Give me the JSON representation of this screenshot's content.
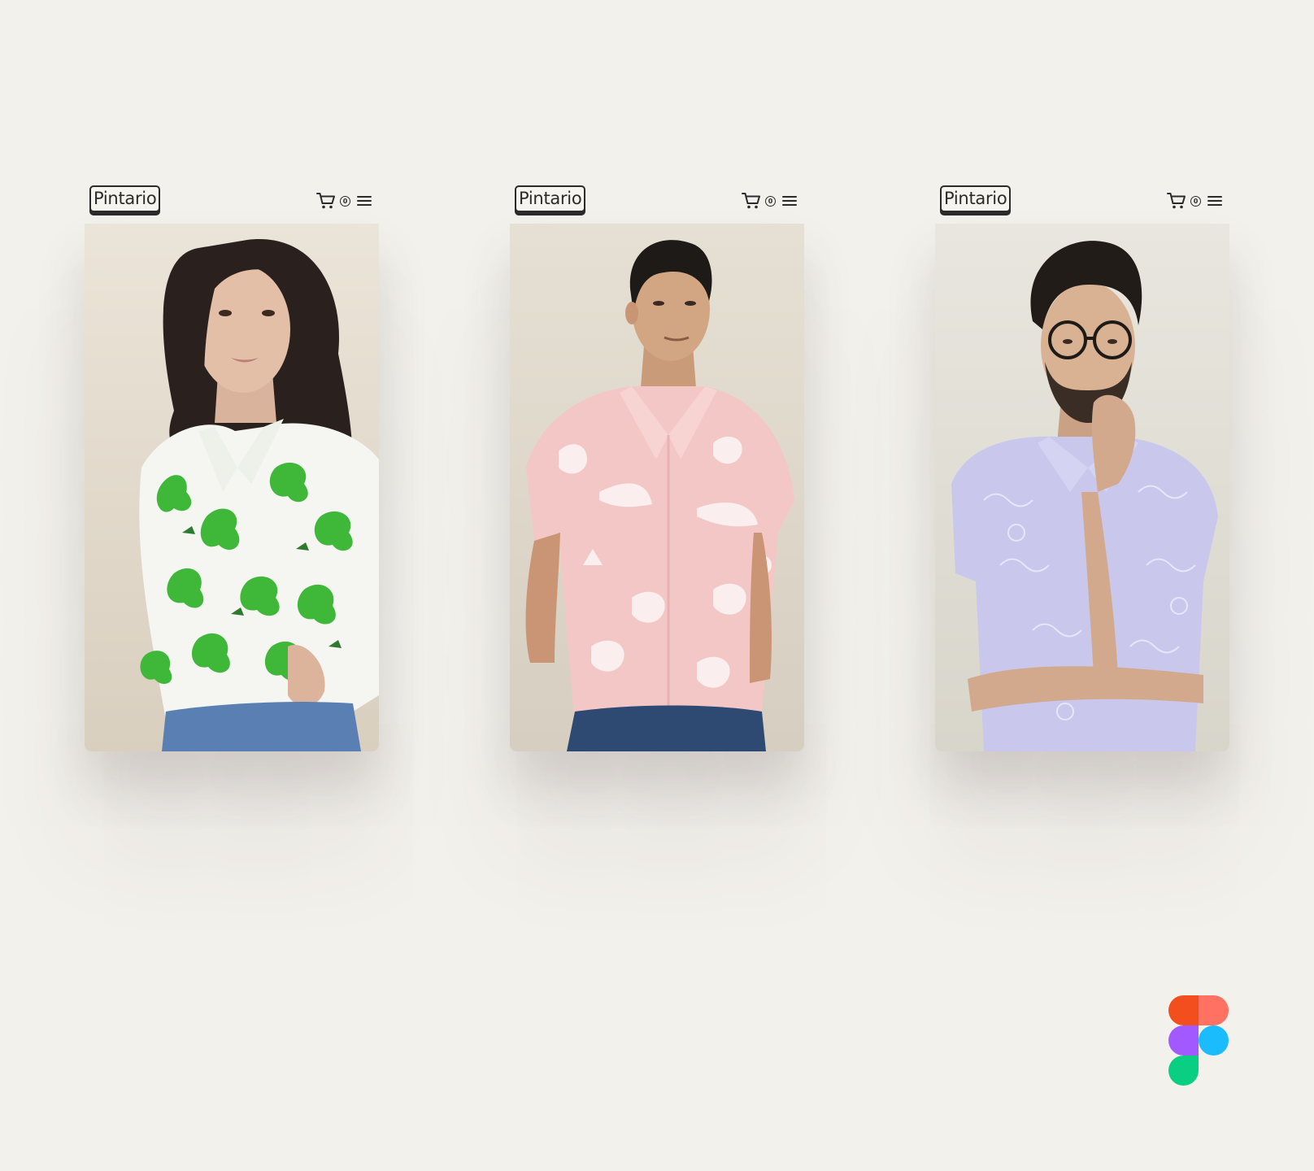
{
  "screens": [
    {
      "logo": "Pintario",
      "cart_count": "0",
      "photo": "woman in white shirt with green lizard print",
      "shirt_color": "#3fb83a",
      "background_color": "#e7dfd2"
    },
    {
      "logo": "Pintario",
      "cart_count": "0",
      "photo": "man in pink shirt with white toucan and flower print",
      "shirt_color": "#f3c7c6",
      "background_color": "#e4ddd1"
    },
    {
      "logo": "Pintario",
      "cart_count": "0",
      "photo": "man with glasses in lavender patterned shirt",
      "shirt_color": "#c9c8ec",
      "background_color": "#e3e1d9"
    }
  ],
  "figma_logo_colors": [
    "#f24e1e",
    "#ff7262",
    "#a259ff",
    "#1abcfe",
    "#0acf83"
  ]
}
